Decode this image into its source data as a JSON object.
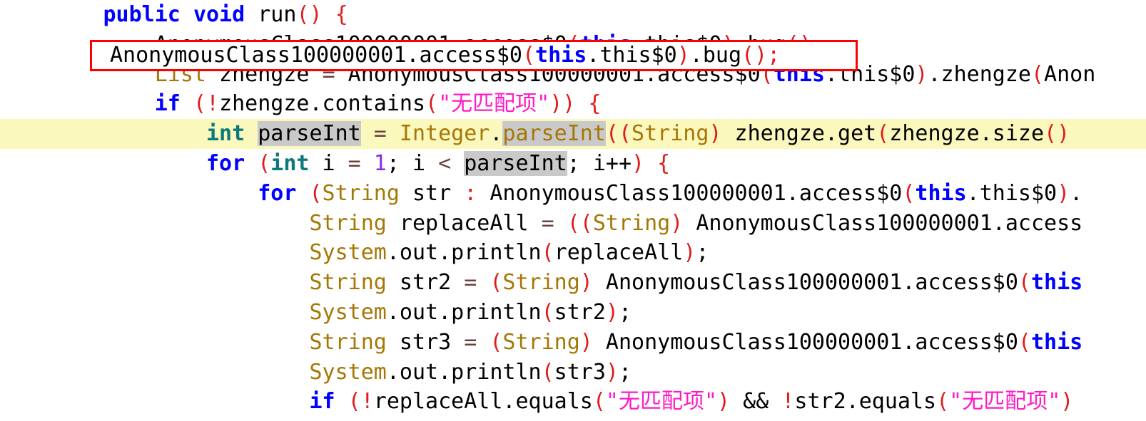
{
  "editor": {
    "kind": "java-decompiled-source-view",
    "font_size_px": 30,
    "colors": {
      "background": "#ffffff",
      "keyword": "#0000ff",
      "primitive_type": "#0c7a7a",
      "type_name": "#a57705",
      "identifier": "#000000",
      "punctuation": "#e01b1b",
      "operator": "#68413f",
      "number_literal": "#8a2be2",
      "string_literal": "#ff1ac6",
      "current_line_highlight": "#fbf8bd",
      "occurrence_highlight": "#c9c9c9",
      "match_box_border": "#ff0000"
    },
    "match_box": {
      "label": "AnonymousClass100000001.access$0(this.this$0).bug();",
      "line_index": 1
    },
    "highlighted_line_index": 4,
    "occurrence_token": "parseInt",
    "lines": [
      {
        "indent": 2,
        "tokens": [
          {
            "text": "public",
            "style": "kw"
          },
          {
            "text": " ",
            "style": "plain"
          },
          {
            "text": "void",
            "style": "kw"
          },
          {
            "text": " run",
            "style": "plain"
          },
          {
            "text": "()",
            "style": "punc"
          },
          {
            "text": " ",
            "style": "plain"
          },
          {
            "text": "{",
            "style": "punc"
          }
        ]
      },
      {
        "indent": 3,
        "tokens": [
          {
            "text": "AnonymousClass100000001.access$0",
            "style": "plain"
          },
          {
            "text": "(",
            "style": "punc"
          },
          {
            "text": "this",
            "style": "this"
          },
          {
            "text": ".this$0",
            "style": "plain"
          },
          {
            "text": ")",
            "style": "punc"
          },
          {
            "text": ".bug",
            "style": "plain"
          },
          {
            "text": "()",
            "style": "punc"
          },
          {
            "text": ";",
            "style": "punc"
          }
        ]
      },
      {
        "indent": 3,
        "tokens": [
          {
            "text": "List",
            "style": "type"
          },
          {
            "text": " zhengze ",
            "style": "plain"
          },
          {
            "text": "=",
            "style": "op"
          },
          {
            "text": " AnonymousClass100000001.access$0",
            "style": "plain"
          },
          {
            "text": "(",
            "style": "punc"
          },
          {
            "text": "this",
            "style": "this"
          },
          {
            "text": ".this$0",
            "style": "plain"
          },
          {
            "text": ")",
            "style": "punc"
          },
          {
            "text": ".zhengze",
            "style": "plain"
          },
          {
            "text": "(",
            "style": "punc"
          },
          {
            "text": "Anon",
            "style": "plain"
          }
        ]
      },
      {
        "indent": 3,
        "tokens": [
          {
            "text": "if",
            "style": "kw"
          },
          {
            "text": " ",
            "style": "plain"
          },
          {
            "text": "(!",
            "style": "punc"
          },
          {
            "text": "zhengze.contains",
            "style": "plain"
          },
          {
            "text": "(",
            "style": "punc"
          },
          {
            "text": "\"无匹配项\"",
            "style": "str"
          },
          {
            "text": "))",
            "style": "punc"
          },
          {
            "text": " ",
            "style": "plain"
          },
          {
            "text": "{",
            "style": "punc"
          }
        ]
      },
      {
        "indent": 4,
        "tokens": [
          {
            "text": "int",
            "style": "kw2"
          },
          {
            "text": " ",
            "style": "plain"
          },
          {
            "text": "parseInt",
            "style": "plain",
            "occurrence": true
          },
          {
            "text": " ",
            "style": "plain"
          },
          {
            "text": "=",
            "style": "op"
          },
          {
            "text": " ",
            "style": "plain"
          },
          {
            "text": "Integer",
            "style": "type"
          },
          {
            "text": ".",
            "style": "plain"
          },
          {
            "text": "parseInt",
            "style": "type",
            "occurrence": true
          },
          {
            "text": "((",
            "style": "punc"
          },
          {
            "text": "String",
            "style": "type"
          },
          {
            "text": ")",
            "style": "punc"
          },
          {
            "text": " zhengze.get",
            "style": "plain"
          },
          {
            "text": "(",
            "style": "punc"
          },
          {
            "text": "zhengze.size",
            "style": "plain"
          },
          {
            "text": "()",
            "style": "punc"
          }
        ]
      },
      {
        "indent": 4,
        "tokens": [
          {
            "text": "for",
            "style": "kw"
          },
          {
            "text": " ",
            "style": "plain"
          },
          {
            "text": "(",
            "style": "punc"
          },
          {
            "text": "int",
            "style": "kw2"
          },
          {
            "text": " i ",
            "style": "plain"
          },
          {
            "text": "=",
            "style": "op"
          },
          {
            "text": " ",
            "style": "plain"
          },
          {
            "text": "1",
            "style": "num"
          },
          {
            "text": ";",
            "style": "plain"
          },
          {
            "text": " i ",
            "style": "plain"
          },
          {
            "text": "<",
            "style": "op"
          },
          {
            "text": " ",
            "style": "plain"
          },
          {
            "text": "parseInt",
            "style": "plain",
            "occurrence": true
          },
          {
            "text": ";",
            "style": "plain"
          },
          {
            "text": " i++",
            "style": "plain"
          },
          {
            "text": ")",
            "style": "punc"
          },
          {
            "text": " ",
            "style": "plain"
          },
          {
            "text": "{",
            "style": "punc"
          }
        ]
      },
      {
        "indent": 5,
        "tokens": [
          {
            "text": "for",
            "style": "kw"
          },
          {
            "text": " ",
            "style": "plain"
          },
          {
            "text": "(",
            "style": "punc"
          },
          {
            "text": "String",
            "style": "type"
          },
          {
            "text": " str ",
            "style": "plain"
          },
          {
            "text": ":",
            "style": "punc"
          },
          {
            "text": " AnonymousClass100000001.access$0",
            "style": "plain"
          },
          {
            "text": "(",
            "style": "punc"
          },
          {
            "text": "this",
            "style": "this"
          },
          {
            "text": ".this$0",
            "style": "plain"
          },
          {
            "text": ")",
            "style": "punc"
          },
          {
            "text": ".",
            "style": "plain"
          }
        ]
      },
      {
        "indent": 6,
        "tokens": [
          {
            "text": "String",
            "style": "type"
          },
          {
            "text": " replaceAll ",
            "style": "plain"
          },
          {
            "text": "=",
            "style": "op"
          },
          {
            "text": " ",
            "style": "plain"
          },
          {
            "text": "((",
            "style": "punc"
          },
          {
            "text": "String",
            "style": "type"
          },
          {
            "text": ")",
            "style": "punc"
          },
          {
            "text": " AnonymousClass100000001.access",
            "style": "plain"
          }
        ]
      },
      {
        "indent": 6,
        "tokens": [
          {
            "text": "System",
            "style": "type"
          },
          {
            "text": ".out.println",
            "style": "plain"
          },
          {
            "text": "(",
            "style": "punc"
          },
          {
            "text": "replaceAll",
            "style": "plain"
          },
          {
            "text": ")",
            "style": "punc"
          },
          {
            "text": ";",
            "style": "plain"
          }
        ]
      },
      {
        "indent": 6,
        "tokens": [
          {
            "text": "String",
            "style": "type"
          },
          {
            "text": " str2 ",
            "style": "plain"
          },
          {
            "text": "=",
            "style": "op"
          },
          {
            "text": " ",
            "style": "plain"
          },
          {
            "text": "(",
            "style": "punc"
          },
          {
            "text": "String",
            "style": "type"
          },
          {
            "text": ")",
            "style": "punc"
          },
          {
            "text": " AnonymousClass100000001.access$0",
            "style": "plain"
          },
          {
            "text": "(",
            "style": "punc"
          },
          {
            "text": "this",
            "style": "this"
          }
        ]
      },
      {
        "indent": 6,
        "tokens": [
          {
            "text": "System",
            "style": "type"
          },
          {
            "text": ".out.println",
            "style": "plain"
          },
          {
            "text": "(",
            "style": "punc"
          },
          {
            "text": "str2",
            "style": "plain"
          },
          {
            "text": ")",
            "style": "punc"
          },
          {
            "text": ";",
            "style": "plain"
          }
        ]
      },
      {
        "indent": 6,
        "tokens": [
          {
            "text": "String",
            "style": "type"
          },
          {
            "text": " str3 ",
            "style": "plain"
          },
          {
            "text": "=",
            "style": "op"
          },
          {
            "text": " ",
            "style": "plain"
          },
          {
            "text": "(",
            "style": "punc"
          },
          {
            "text": "String",
            "style": "type"
          },
          {
            "text": ")",
            "style": "punc"
          },
          {
            "text": " AnonymousClass100000001.access$0",
            "style": "plain"
          },
          {
            "text": "(",
            "style": "punc"
          },
          {
            "text": "this",
            "style": "this"
          }
        ]
      },
      {
        "indent": 6,
        "tokens": [
          {
            "text": "System",
            "style": "type"
          },
          {
            "text": ".out.println",
            "style": "plain"
          },
          {
            "text": "(",
            "style": "punc"
          },
          {
            "text": "str3",
            "style": "plain"
          },
          {
            "text": ")",
            "style": "punc"
          },
          {
            "text": ";",
            "style": "plain"
          }
        ]
      },
      {
        "indent": 6,
        "tokens": [
          {
            "text": "if",
            "style": "kw"
          },
          {
            "text": " ",
            "style": "plain"
          },
          {
            "text": "(!",
            "style": "punc"
          },
          {
            "text": "replaceAll.equals",
            "style": "plain"
          },
          {
            "text": "(",
            "style": "punc"
          },
          {
            "text": "\"无匹配项\"",
            "style": "str"
          },
          {
            "text": ")",
            "style": "punc"
          },
          {
            "text": " && ",
            "style": "plain"
          },
          {
            "text": "!",
            "style": "punc"
          },
          {
            "text": "str2.equals",
            "style": "plain"
          },
          {
            "text": "(",
            "style": "punc"
          },
          {
            "text": "\"无匹配项\"",
            "style": "str"
          },
          {
            "text": ")",
            "style": "punc"
          }
        ]
      }
    ]
  }
}
